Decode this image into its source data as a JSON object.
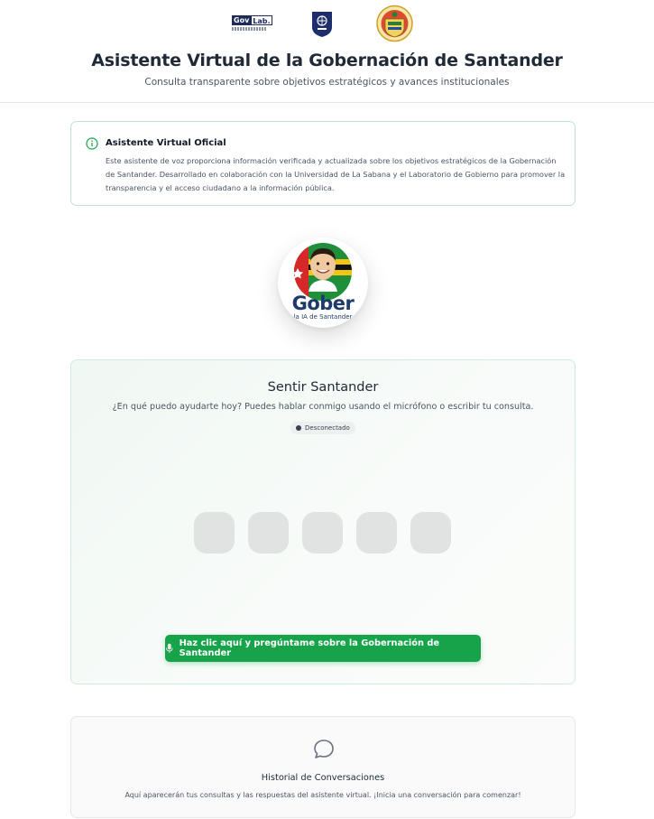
{
  "header": {
    "title": "Asistente Virtual de la Gobernación de Santander",
    "subtitle": "Consulta transparente sobre objetivos estratégicos y avances institucionales",
    "logos": {
      "govlab_gov": "Gov",
      "govlab_lab": "Lab."
    }
  },
  "info_card": {
    "icon": "info-icon",
    "title": "Asistente Virtual Oficial",
    "body": "Este asistente de voz proporciona información verificada y actualizada sobre los objetivos estratégicos de la Gobernación de Santander. Desarrollado en colaboración con la Universidad de La Sabana y el Laboratorio de Gobierno para promover la transparencia y el acceso ciudadano a la información pública."
  },
  "avatar": {
    "name": "Gober",
    "tagline": "la IA de Santander"
  },
  "assistant": {
    "title": "Sentir Santander",
    "prompt": "¿En qué puedo ayudarte hoy? Puedes hablar conmigo usando el micrófono o escribir tu consulta.",
    "status": "Desconectado",
    "cta_label": "Haz clic aquí y pregúntame sobre la Gobernación de Santander",
    "cta_icon": "microphone-icon"
  },
  "history": {
    "icon": "chat-bubble-icon",
    "title": "Historial de Conversaciones",
    "empty_message": "Aquí aparecerán tus consultas y las respuestas del asistente virtual. ¡Inicia una conversación para comenzar!"
  },
  "colors": {
    "accent": "#16a34a",
    "navy": "#1e3a6b",
    "card_border": "#bfe5cf"
  }
}
